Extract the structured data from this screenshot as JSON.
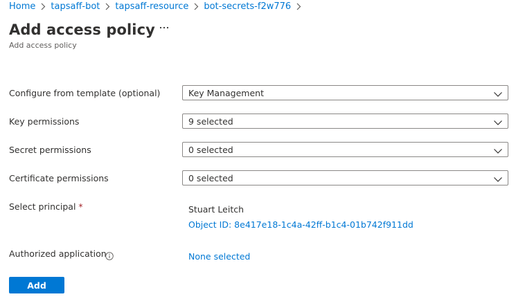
{
  "breadcrumb": {
    "items": [
      "Home",
      "tapsaff-bot",
      "tapsaff-resource",
      "bot-secrets-f2w776"
    ]
  },
  "page": {
    "title": "Add access policy",
    "subtitle": "Add access policy"
  },
  "form": {
    "template": {
      "label": "Configure from template (optional)",
      "value": "Key Management"
    },
    "key_permissions": {
      "label": "Key permissions",
      "value": "9 selected"
    },
    "secret_permissions": {
      "label": "Secret permissions",
      "value": "0 selected"
    },
    "certificate_permissions": {
      "label": "Certificate permissions",
      "value": "0 selected"
    },
    "principal": {
      "label": "Select principal",
      "required_mark": "*",
      "name": "Stuart Leitch",
      "object_id": "Object ID: 8e417e18-1c4a-42ff-b1c4-01b742f911dd"
    },
    "authorized_application": {
      "label": "Authorized application",
      "value": "None selected"
    }
  },
  "actions": {
    "add_label": "Add"
  },
  "colors": {
    "accent": "#0078d4",
    "text": "#323130",
    "required": "#a4262c",
    "border": "#8a8886"
  },
  "icons": {
    "breadcrumb_separator": "chevron-right-icon",
    "more": "ellipsis-icon",
    "dropdown": "chevron-down-icon",
    "info": "info-icon"
  }
}
